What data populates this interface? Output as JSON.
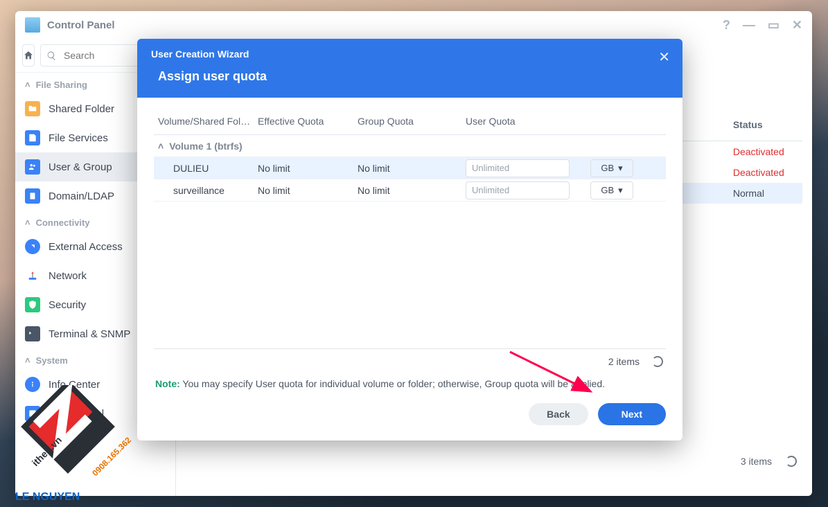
{
  "window": {
    "title": "Control Panel"
  },
  "search": {
    "placeholder": "Search"
  },
  "sidebar": {
    "groups": {
      "file_sharing": {
        "label": "File Sharing"
      },
      "connectivity": {
        "label": "Connectivity"
      },
      "system": {
        "label": "System"
      }
    },
    "items": {
      "shared_folder": {
        "label": "Shared Folder"
      },
      "file_services": {
        "label": "File Services"
      },
      "user_group": {
        "label": "User & Group"
      },
      "domain_ldap": {
        "label": "Domain/LDAP"
      },
      "external": {
        "label": "External Access"
      },
      "network": {
        "label": "Network"
      },
      "security": {
        "label": "Security"
      },
      "terminal": {
        "label": "Terminal & SNMP"
      },
      "info_center": {
        "label": "Info Center"
      },
      "login_portal": {
        "label": "Login Portal"
      }
    }
  },
  "bg_table": {
    "status_header": "Status",
    "rows": [
      {
        "status": "Deactivated",
        "status_class": ""
      },
      {
        "status": "Deactivated",
        "status_class": ""
      },
      {
        "status": "Normal",
        "status_class": "normal"
      }
    ],
    "items_count": "3 items"
  },
  "wizard": {
    "header": "User Creation Wizard",
    "subtitle": "Assign user quota",
    "columns": {
      "volume": "Volume/Shared Fol…",
      "effective": "Effective Quota",
      "group": "Group Quota",
      "user": "User Quota"
    },
    "volume_group": "Volume 1 (btrfs)",
    "rows": [
      {
        "name": "DULIEU",
        "effective": "No limit",
        "group": "No limit",
        "user_placeholder": "Unlimited",
        "unit": "GB"
      },
      {
        "name": "surveillance",
        "effective": "No limit",
        "group": "No limit",
        "user_placeholder": "Unlimited",
        "unit": "GB"
      }
    ],
    "items_count": "2 items",
    "note_label": "Note:",
    "note_text": " You may specify User quota for individual volume or folder; otherwise, Group quota will be applied.",
    "back": "Back",
    "next": "Next"
  },
  "watermark": {
    "brand": "LE NGUYEN",
    "site": "ithen.vn",
    "phone": "0908.165.362"
  }
}
